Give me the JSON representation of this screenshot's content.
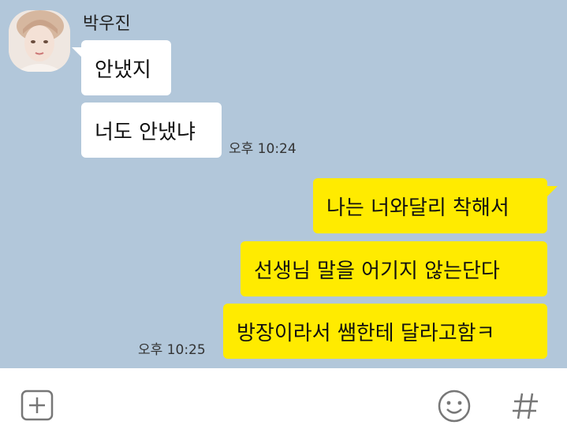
{
  "sender": {
    "name": "박우진"
  },
  "messages_in": [
    {
      "text": "안냈지"
    },
    {
      "text": "너도 안냈냐"
    }
  ],
  "time_in": "오후 10:24",
  "messages_out": [
    {
      "text": "나는 너와달리 착해서"
    },
    {
      "text": "선생님 말을 어기지 않는단다"
    },
    {
      "text": "방장이라서 쌤한테 달라고함ㅋ"
    }
  ],
  "time_out": "오후 10:25",
  "toolbar": {
    "icons": [
      "plus-box-icon",
      "emoji-icon",
      "hash-icon"
    ]
  },
  "colors": {
    "chat_background": "#b2c7da",
    "incoming_bubble": "#ffffff",
    "outgoing_bubble": "#ffeb00"
  }
}
